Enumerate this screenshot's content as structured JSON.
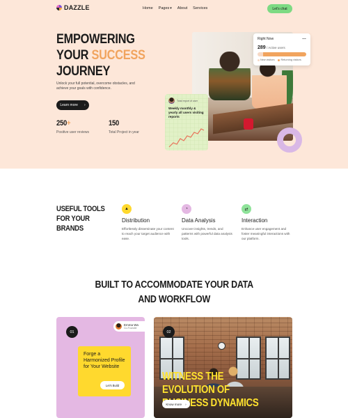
{
  "nav": {
    "logo_text": "DAZZLE",
    "links": [
      "Home",
      "Pages",
      "About",
      "Services"
    ],
    "cta": "Let's chat"
  },
  "hero": {
    "title_line1": "EMPOWERING",
    "title_line2_prefix": "YOUR ",
    "title_line2_accent": "SUCCESS",
    "title_line3": "JOURNEY",
    "subtitle": "Unlock your full potential, overcome obstacles, and achieve your goals with confidence.",
    "button": "Learn more",
    "stats": [
      {
        "value": "250",
        "suffix": "+",
        "label": "Positive user reviews"
      },
      {
        "value": "150",
        "suffix": "",
        "label": "Total Project in year"
      }
    ],
    "accent_color": "#f1a45e",
    "background": "#fde7d9"
  },
  "right_now_card": {
    "title": "Right Now",
    "count": "289",
    "count_label": "/ Active users",
    "new_fraction": 0.12,
    "legend_new": "New visitors",
    "legend_returning": "Returning visitors"
  },
  "report_card": {
    "caption": "Total report of user",
    "title": "Weekly monthly & yearly all users visiting reports"
  },
  "tools": {
    "title_lines": [
      "USEFUL TOOLS",
      "FOR YOUR",
      "BRANDS"
    ],
    "features": [
      {
        "title": "Distribution",
        "desc": "Effortlessly disseminate your content to reach your target audience with ease.",
        "icon": "distribution-icon",
        "icon_bg": "#ffd92e"
      },
      {
        "title": "Data Analysis",
        "desc": "Uncover insights, trends, and patterns with powerful data analysis tools.",
        "icon": "data-analysis-icon",
        "icon_bg": "#e4b8e3"
      },
      {
        "title": "Interaction",
        "desc": "Enhance user engagement and foster meaningful interactions with our platform.",
        "icon": "interaction-icon",
        "icon_bg": "#8fe39a"
      }
    ]
  },
  "built": {
    "title_line1": "BUILT TO ACCOMMODATE YOUR DATA",
    "title_line2": "AND WORKFLOW"
  },
  "card1": {
    "number": "01",
    "profile_name": "Emma Wa",
    "profile_role": "Co-Founder",
    "headline": "Forge a Harmonized Profile for Your Website",
    "button": "Let's Build"
  },
  "card2": {
    "number": "02",
    "headline_line1": "WITNESS THE EVOLUTION OF",
    "headline_line2": "BUSINESS DYNAMICS",
    "button": "Know more"
  }
}
